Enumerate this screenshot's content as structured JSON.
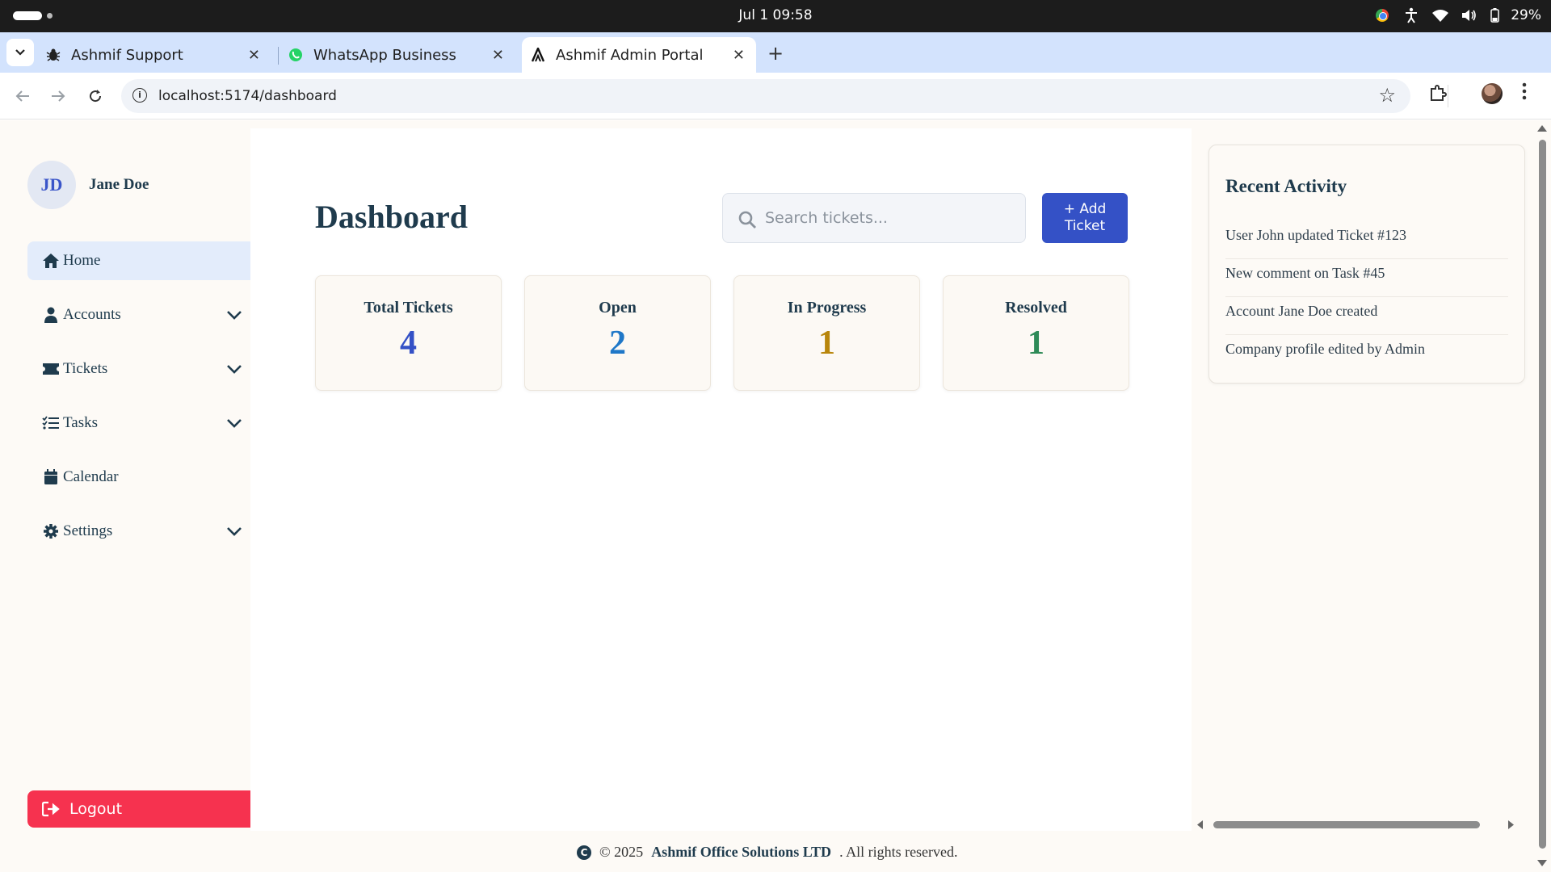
{
  "os": {
    "clock": "Jul 1  09:58",
    "battery": "29%"
  },
  "tabs": [
    {
      "title": "Ashmif Support"
    },
    {
      "title": "WhatsApp Business"
    },
    {
      "title": "Ashmif Admin Portal"
    }
  ],
  "address": {
    "url": "localhost:5174/dashboard"
  },
  "user": {
    "initials": "JD",
    "name": "Jane Doe"
  },
  "nav": {
    "home": "Home",
    "accounts": "Accounts",
    "tickets": "Tickets",
    "tasks": "Tasks",
    "calendar": "Calendar",
    "settings": "Settings",
    "logout": "Logout"
  },
  "main": {
    "title": "Dashboard",
    "search_placeholder": "Search tickets...",
    "add_line1": "+ Add",
    "add_line2": "Ticket"
  },
  "stats": [
    {
      "label": "Total Tickets",
      "value": "4",
      "color": "#3451c6"
    },
    {
      "label": "Open",
      "value": "2",
      "color": "#1f78c8"
    },
    {
      "label": "In Progress",
      "value": "1",
      "color": "#b8860b"
    },
    {
      "label": "Resolved",
      "value": "1",
      "color": "#2e8b57"
    }
  ],
  "activity": {
    "title": "Recent Activity",
    "items": [
      "User John updated Ticket #123",
      "New comment on Task #45",
      "Account Jane Doe created",
      "Company profile edited by Admin"
    ]
  },
  "footer": {
    "year_text": "© 2025",
    "company": "Ashmif Office Solutions LTD",
    "rights": ". All rights reserved."
  },
  "colors": {
    "accent": "#3451c6",
    "logout": "#f6324f",
    "tabstrip": "#d3e3fd"
  }
}
